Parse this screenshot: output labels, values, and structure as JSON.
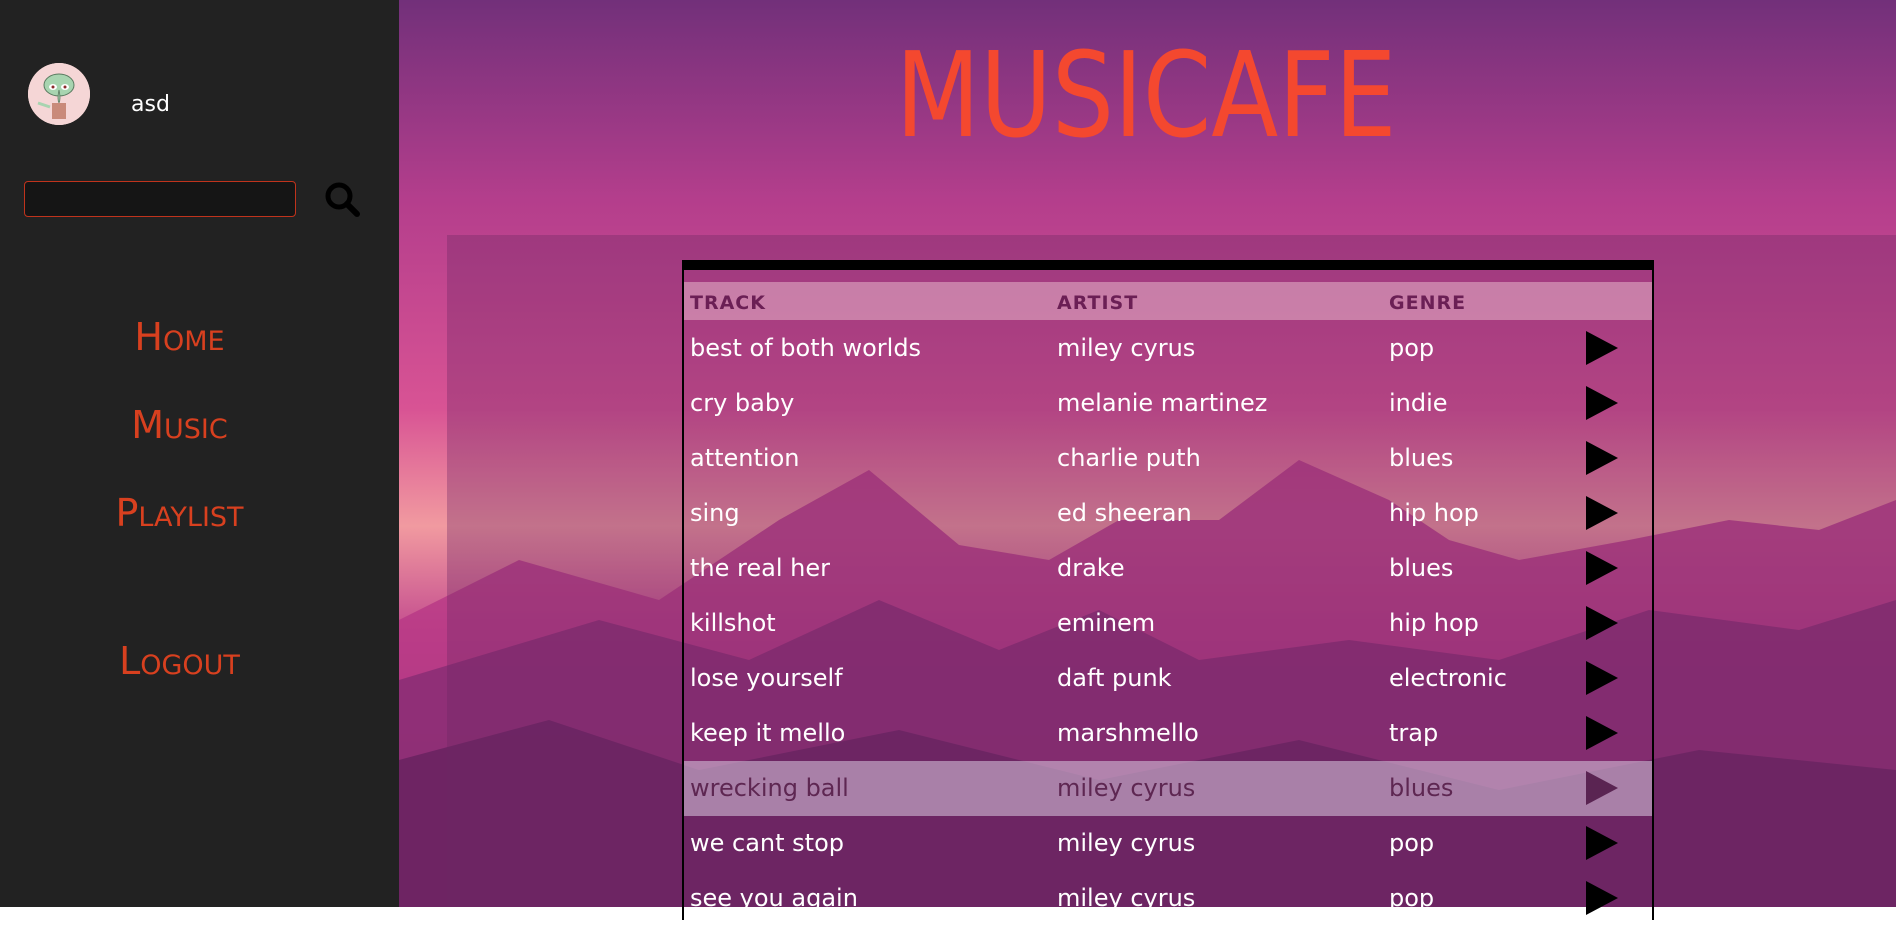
{
  "user": {
    "name": "asd",
    "avatar_icon": "squidward-avatar"
  },
  "search": {
    "placeholder": "",
    "icon": "search-icon"
  },
  "nav": {
    "home": "Home",
    "music": "Music",
    "playlist": "Playlist",
    "logout": "Logout"
  },
  "header": {
    "title": "MUSICAFE"
  },
  "table": {
    "columns": {
      "track": "TRACK",
      "artist": "ARTIST",
      "genre": "GENRE"
    },
    "rows": [
      {
        "track": "best of both worlds",
        "artist": "miley cyrus",
        "genre": "pop"
      },
      {
        "track": "cry baby",
        "artist": "melanie martinez",
        "genre": "indie"
      },
      {
        "track": "attention",
        "artist": "charlie puth",
        "genre": "blues"
      },
      {
        "track": "sing",
        "artist": "ed sheeran",
        "genre": "hip hop"
      },
      {
        "track": "the real her",
        "artist": "drake",
        "genre": "blues"
      },
      {
        "track": "killshot",
        "artist": "eminem",
        "genre": "hip hop"
      },
      {
        "track": "lose yourself",
        "artist": "daft punk",
        "genre": "electronic"
      },
      {
        "track": "keep it mello",
        "artist": "marshmello",
        "genre": "trap"
      },
      {
        "track": "wrecking ball",
        "artist": "miley cyrus",
        "genre": "blues"
      },
      {
        "track": "we cant stop",
        "artist": "miley cyrus",
        "genre": "pop"
      },
      {
        "track": "see you again",
        "artist": "miley cyrus",
        "genre": "pop"
      }
    ]
  },
  "colors": {
    "accent": "#d8401f",
    "title": "#f4482f",
    "sidebar_bg": "#222222"
  }
}
